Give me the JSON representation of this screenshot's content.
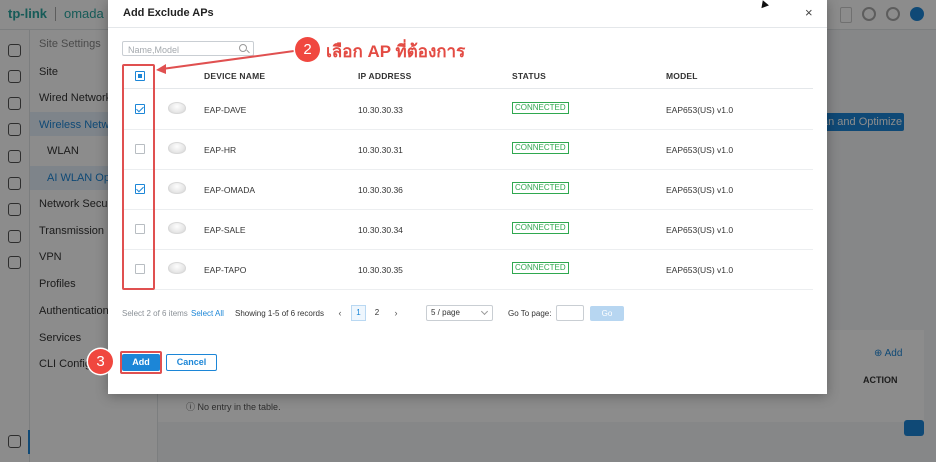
{
  "app": {
    "logo_brand": "tp-link",
    "logo_product": "omada",
    "sidebar": [
      {
        "label": "Site Settings"
      },
      {
        "label": "Site"
      },
      {
        "label": "Wired Networks"
      },
      {
        "label": "Wireless Networks"
      },
      {
        "label": "WLAN"
      },
      {
        "label": "AI WLAN Optimiz"
      },
      {
        "label": "Network Security"
      },
      {
        "label": "Transmission"
      },
      {
        "label": "VPN"
      },
      {
        "label": "Profiles"
      },
      {
        "label": "Authentication"
      },
      {
        "label": "Services"
      },
      {
        "label": "CLI Configura"
      }
    ],
    "scan_button": "an and Optimize",
    "add_link": "Add",
    "action_header": "ACTION",
    "empty_text": "No entry in the table."
  },
  "modal": {
    "title": "Add Exclude APs",
    "close": "×",
    "search_placeholder": "Name,Model",
    "columns": {
      "device": "DEVICE NAME",
      "ip": "IP ADDRESS",
      "status": "STATUS",
      "model": "MODEL"
    },
    "rows": [
      {
        "name": "EAP-DAVE",
        "ip": "10.30.30.33",
        "status": "CONNECTED",
        "model": "EAP653(US) v1.0",
        "checked": true
      },
      {
        "name": "EAP-HR",
        "ip": "10.30.30.31",
        "status": "CONNECTED",
        "model": "EAP653(US) v1.0",
        "checked": false
      },
      {
        "name": "EAP-OMADA",
        "ip": "10.30.30.36",
        "status": "CONNECTED",
        "model": "EAP653(US) v1.0",
        "checked": true
      },
      {
        "name": "EAP-SALE",
        "ip": "10.30.30.34",
        "status": "CONNECTED",
        "model": "EAP653(US) v1.0",
        "checked": false
      },
      {
        "name": "EAP-TAPO",
        "ip": "10.30.30.35",
        "status": "CONNECTED",
        "model": "EAP653(US) v1.0",
        "checked": false
      }
    ],
    "footer": {
      "select_info": "Select 2 of 6 items",
      "select_all": "Select All",
      "showing": "Showing 1-5 of 6 records",
      "prev": "‹",
      "page1": "1",
      "page2": "2",
      "next": "›",
      "per_page": "5 / page",
      "goto_label": "Go To page:",
      "go": "Go"
    },
    "add_button": "Add",
    "cancel_button": "Cancel"
  },
  "annotations": {
    "step2": "2",
    "step2_text": "เลือก AP ที่ต้องการ",
    "step3": "3",
    "color": "#e05050"
  }
}
